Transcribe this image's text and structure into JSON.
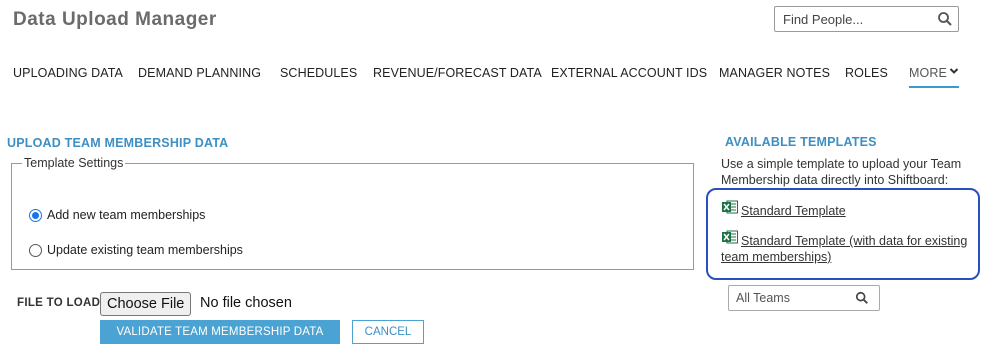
{
  "app": {
    "title": "Data Upload Manager"
  },
  "search": {
    "placeholder": "Find People...",
    "icon": "search-icon"
  },
  "nav": {
    "items": [
      {
        "label": "UPLOADING DATA"
      },
      {
        "label": "DEMAND PLANNING"
      },
      {
        "label": "SCHEDULES"
      },
      {
        "label": "REVENUE/FORECAST DATA"
      },
      {
        "label": "EXTERNAL ACCOUNT IDS"
      },
      {
        "label": "MANAGER NOTES"
      },
      {
        "label": "ROLES"
      },
      {
        "label": "MORE",
        "active": true,
        "icon": "chevron-down-icon"
      }
    ]
  },
  "upload": {
    "title": "UPLOAD TEAM MEMBERSHIP DATA",
    "settings_legend": "Template Settings",
    "options": [
      {
        "label": "Add new team memberships",
        "selected": true
      },
      {
        "label": "Update existing team memberships",
        "selected": false
      }
    ],
    "file_label": "FILE TO LOAD:",
    "choose_file": "Choose File",
    "no_file": "No file chosen",
    "validate_label": "VALIDATE TEAM MEMBERSHIP DATA",
    "cancel_label": "CANCEL"
  },
  "templates": {
    "title": "AVAILABLE TEMPLATES",
    "description": "Use a simple template to upload your Team Membership data directly into Shiftboard:",
    "links": [
      {
        "label": "Standard Template",
        "icon": "excel-icon"
      },
      {
        "label": "Standard Template (with data for existing team memberships)",
        "icon": "excel-icon"
      }
    ],
    "teams_placeholder": "All Teams"
  },
  "colors": {
    "accent": "#3d8fc4",
    "button_primary": "#4ba3d3",
    "highlight_border": "#2a4fbf",
    "excel_green": "#1e7145"
  }
}
